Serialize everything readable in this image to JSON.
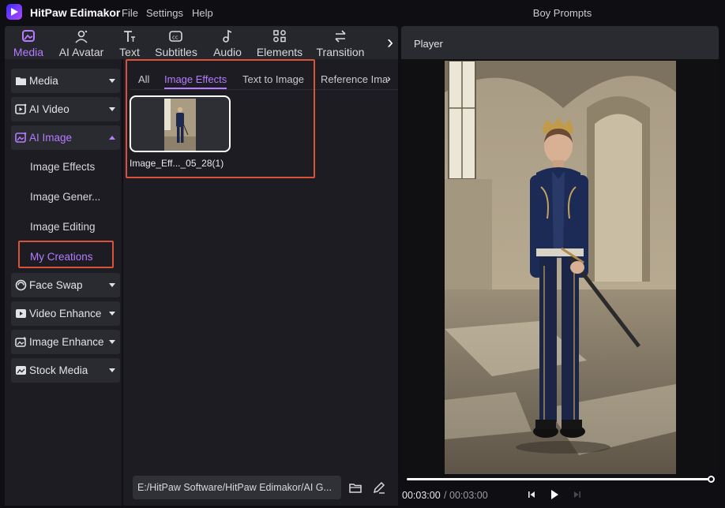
{
  "app": {
    "name": "HitPaw Edimakor",
    "document_title": "Boy Prompts"
  },
  "menu": [
    "File",
    "Settings",
    "Help"
  ],
  "toolbar": {
    "tools": [
      {
        "label": "Media",
        "icon": "media-icon"
      },
      {
        "label": "AI Avatar",
        "icon": "avatar-icon"
      },
      {
        "label": "Text",
        "icon": "text-icon"
      },
      {
        "label": "Subtitles",
        "icon": "subtitles-icon"
      },
      {
        "label": "Audio",
        "icon": "audio-icon"
      },
      {
        "label": "Elements",
        "icon": "elements-icon"
      },
      {
        "label": "Transition",
        "icon": "transition-icon"
      }
    ],
    "active": "Media"
  },
  "sidebar": {
    "groups": [
      {
        "label": "Media",
        "icon": "folder-icon"
      },
      {
        "label": "AI Video",
        "icon": "ai-video-icon"
      },
      {
        "label": "AI Image",
        "icon": "ai-image-icon",
        "expanded": true
      },
      {
        "label": "Face Swap",
        "icon": "face-swap-icon"
      },
      {
        "label": "Video Enhance",
        "icon": "video-enhance-icon"
      },
      {
        "label": "Image Enhance",
        "icon": "image-enhance-icon"
      },
      {
        "label": "Stock Media",
        "icon": "stock-media-icon"
      }
    ],
    "ai_image_items": [
      "Image Effects",
      "Image Gener...",
      "Image Editing",
      "My Creations"
    ],
    "active_item": "My Creations"
  },
  "content": {
    "tabs": [
      "All",
      "Image Effects",
      "Text to Image",
      "Reference Imag"
    ],
    "active_tab": "Image Effects",
    "items": [
      {
        "caption": "Image_Eff..._05_28(1)"
      }
    ]
  },
  "footer": {
    "path": "E:/HitPaw Software/HitPaw Edimakor/AI G..."
  },
  "player": {
    "title": "Player",
    "current_time": "00:03:00",
    "separator": "/",
    "total_time": "00:03:00",
    "progress": 1.0
  },
  "colors": {
    "accent": "#b57cff",
    "highlight": "#d9533b",
    "background": "#1c1c22"
  }
}
